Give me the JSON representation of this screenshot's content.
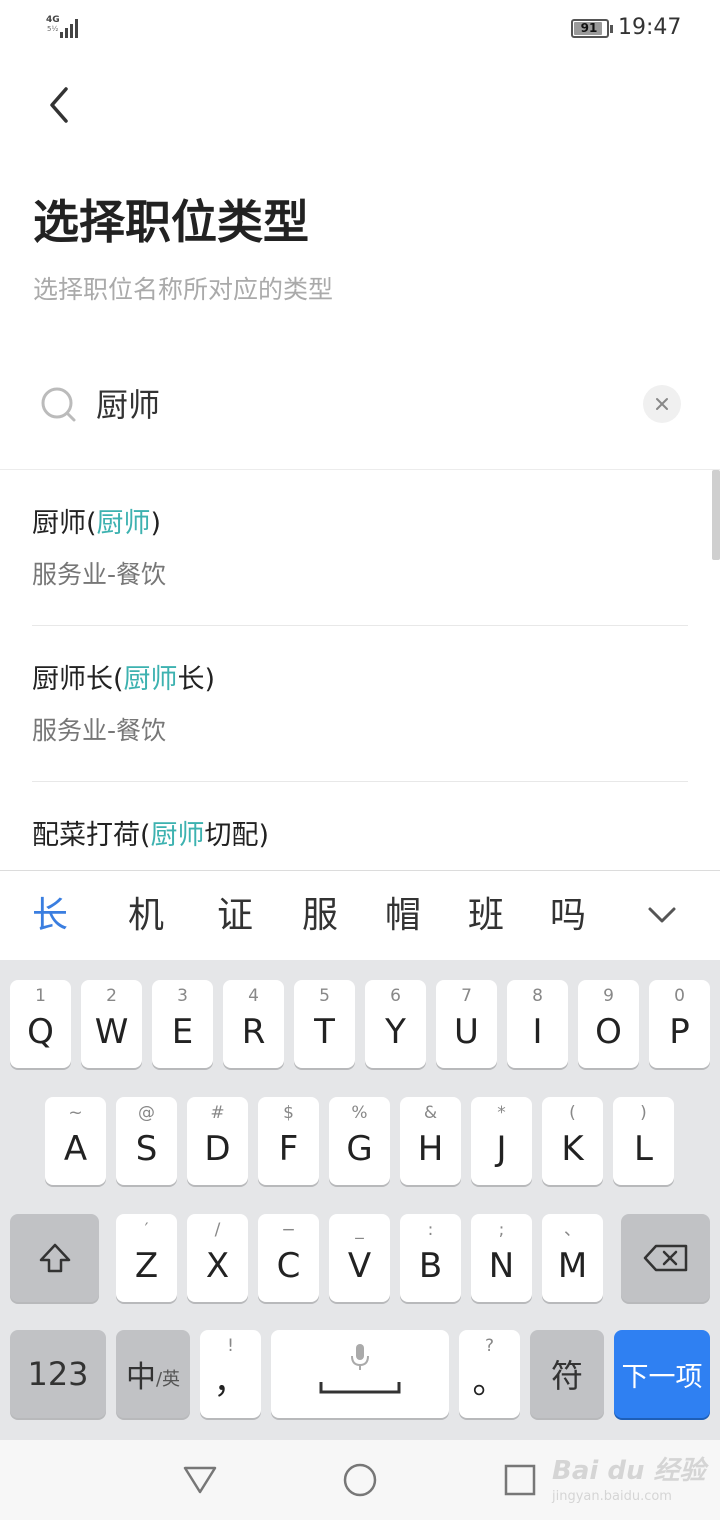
{
  "status": {
    "network": "4G",
    "network_sub": "5½",
    "battery": "91",
    "time": "19:47"
  },
  "header": {
    "back_icon": "chevron-left-icon",
    "title": "选择职位类型",
    "subtitle": "选择职位名称所对应的类型"
  },
  "search": {
    "icon": "search-icon",
    "value": "厨师",
    "clear_icon": "close-icon"
  },
  "results": [
    {
      "name_pre": "厨师(",
      "name_hl": "厨师",
      "name_post": ")",
      "category": "服务业-餐饮"
    },
    {
      "name_pre": "厨师长(",
      "name_hl": "厨师",
      "name_post": "长)",
      "category": "服务业-餐饮"
    },
    {
      "name_pre": "配菜打荷(",
      "name_hl": "厨师",
      "name_post": "切配)",
      "category": ""
    }
  ],
  "candidates": [
    "长",
    "机",
    "证",
    "服",
    "帽",
    "班",
    "吗"
  ],
  "keyboard": {
    "row1": [
      {
        "sec": "1",
        "pri": "Q"
      },
      {
        "sec": "2",
        "pri": "W"
      },
      {
        "sec": "3",
        "pri": "E"
      },
      {
        "sec": "4",
        "pri": "R"
      },
      {
        "sec": "5",
        "pri": "T"
      },
      {
        "sec": "6",
        "pri": "Y"
      },
      {
        "sec": "7",
        "pri": "U"
      },
      {
        "sec": "8",
        "pri": "I"
      },
      {
        "sec": "9",
        "pri": "O"
      },
      {
        "sec": "0",
        "pri": "P"
      }
    ],
    "row2": [
      {
        "sec": "~",
        "pri": "A"
      },
      {
        "sec": "@",
        "pri": "S"
      },
      {
        "sec": "#",
        "pri": "D"
      },
      {
        "sec": "$",
        "pri": "F"
      },
      {
        "sec": "%",
        "pri": "G"
      },
      {
        "sec": "&",
        "pri": "H"
      },
      {
        "sec": "*",
        "pri": "J"
      },
      {
        "sec": "(",
        "pri": "K"
      },
      {
        "sec": ")",
        "pri": "L"
      }
    ],
    "row3": [
      {
        "sec": "′",
        "pri": "Z"
      },
      {
        "sec": "/",
        "pri": "X"
      },
      {
        "sec": "−",
        "pri": "C"
      },
      {
        "sec": "_",
        "pri": "V"
      },
      {
        "sec": ":",
        "pri": "B"
      },
      {
        "sec": ";",
        "pri": "N"
      },
      {
        "sec": "、",
        "pri": "M"
      }
    ],
    "shift_icon": "shift-icon",
    "backspace_icon": "backspace-icon",
    "num_label": "123",
    "lang_main": "中",
    "lang_sub": "/英",
    "comma_sec": "!",
    "comma_pri": "，",
    "mic_icon": "microphone-icon",
    "period_sec": "?",
    "period_pri": "。",
    "symbol_label": "符",
    "next_label": "下一项"
  },
  "nav": {
    "back_icon": "triangle-back-icon",
    "home_icon": "circle-home-icon",
    "recent_icon": "square-recent-icon"
  },
  "watermark": {
    "line1": "Bai du 经验",
    "line2": "jingyan.baidu.com"
  }
}
